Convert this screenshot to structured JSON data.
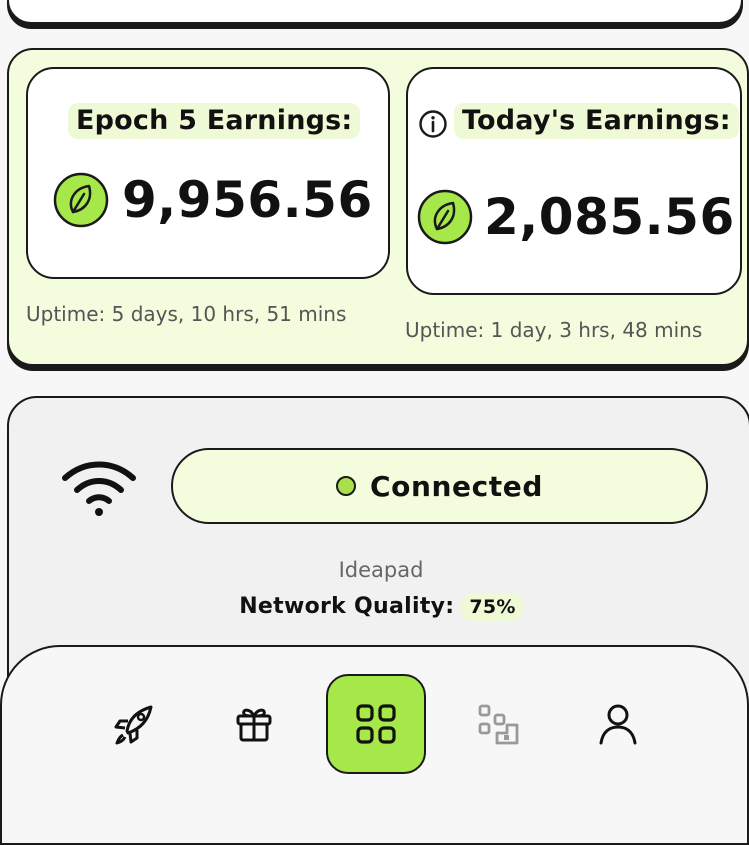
{
  "earnings": {
    "epoch": {
      "label": "Epoch 5 Earnings:",
      "value": "9,956.56",
      "uptime": "Uptime: 5 days, 10 hrs, 51 mins"
    },
    "today": {
      "label": "Today's Earnings:",
      "value": "2,085.56",
      "uptime": "Uptime: 1 day, 3 hrs, 48 mins"
    }
  },
  "connection": {
    "status": "Connected",
    "device": "Ideapad",
    "quality_label": "Network Quality:",
    "quality_value": "75%"
  },
  "nav": {
    "items": [
      {
        "icon": "rocket-icon",
        "active": false
      },
      {
        "icon": "gift-icon",
        "active": false
      },
      {
        "icon": "dashboard-grid-icon",
        "active": true
      },
      {
        "icon": "qr-code-icon",
        "active": false
      },
      {
        "icon": "user-icon",
        "active": false
      }
    ]
  },
  "colors": {
    "accent": "#a6e84a",
    "panel_tint": "#f3fcdc",
    "border": "#1a1a1a"
  }
}
